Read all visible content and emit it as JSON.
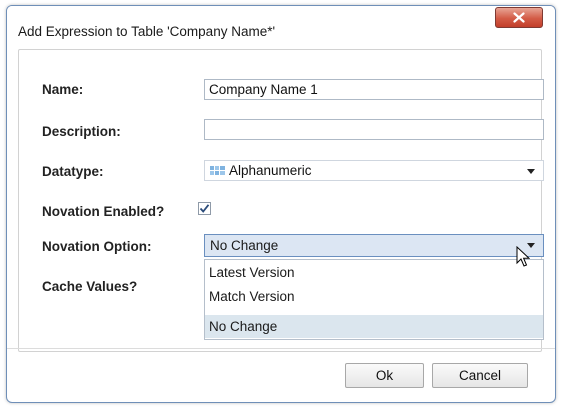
{
  "dialog": {
    "title": "Add Expression to Table 'Company Name*'",
    "close_icon": "close-x-icon"
  },
  "form": {
    "name_label": "Name:",
    "name_value": "Company Name 1",
    "description_label": "Description:",
    "description_value": "",
    "datatype_label": "Datatype:",
    "datatype_value": "Alphanumeric",
    "datatype_icon": "alphanumeric-grid-icon",
    "novation_enabled_label": "Novation Enabled?",
    "novation_enabled_checked": true,
    "novation_option_label": "Novation Option:",
    "novation_option_value": "No Change",
    "novation_options": [
      "Latest Version",
      "Match Version",
      "No Change"
    ],
    "cache_values_label": "Cache Values?"
  },
  "buttons": {
    "ok": "Ok",
    "cancel": "Cancel"
  },
  "colors": {
    "close_button": "#d35b46",
    "selected_option": "#dbe6ee",
    "open_select": "#dce6f3"
  }
}
